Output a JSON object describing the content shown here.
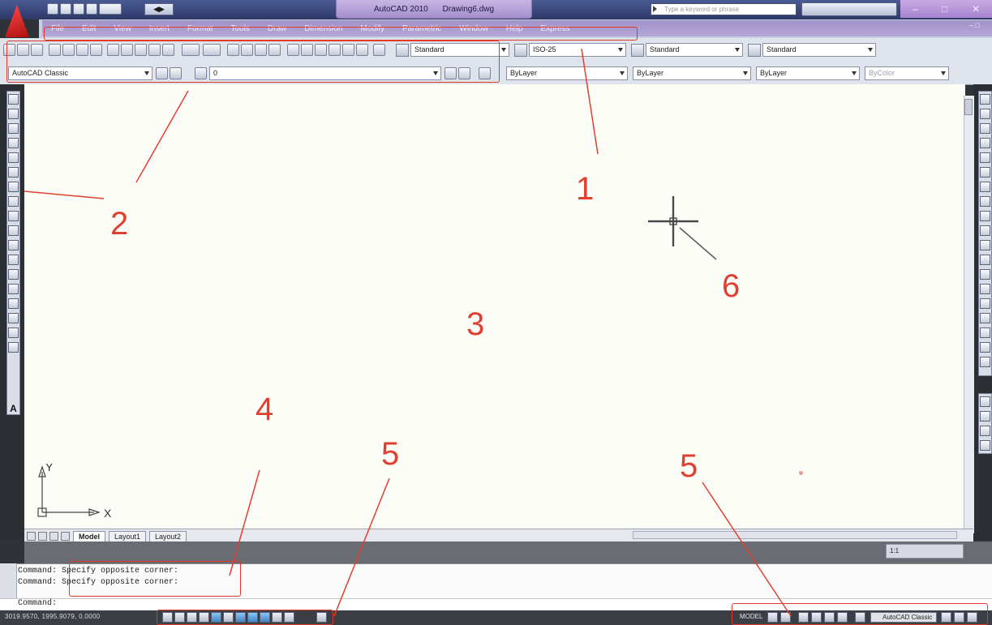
{
  "window": {
    "app_name": "AutoCAD 2010",
    "file_name": "Drawing6.dwg",
    "search_placeholder": "Type a keyword or phrase",
    "workspace_mini": "◀▶"
  },
  "menu": {
    "items": [
      "File",
      "Edit",
      "View",
      "Insert",
      "Format",
      "Tools",
      "Draw",
      "Dimension",
      "Modify",
      "Parametric",
      "Window",
      "Help",
      "Express"
    ]
  },
  "toolbar1": {
    "text_style": "Standard",
    "dim_style": "ISO-25",
    "table_style": "Standard",
    "multileader_style": "Standard"
  },
  "toolbar2": {
    "workspace": "AutoCAD Classic",
    "layer": "0",
    "color": "ByLayer",
    "linetype": "ByLayer",
    "lineweight": "ByLayer",
    "plotstyle": "ByColor"
  },
  "layout_tabs": [
    "Model",
    "Layout1",
    "Layout2"
  ],
  "command": {
    "line1": "Command: Specify opposite corner:",
    "line2": "Command: Specify opposite corner:",
    "prompt": "Command:"
  },
  "status": {
    "coordinates": "3019.9570, 1995.9079, 0.0000",
    "model": "MODEL",
    "workspace": "AutoCAD Classic"
  },
  "ucs": {
    "x_label": "X",
    "y_label": "Y"
  },
  "viewport": {
    "scale": "1:1"
  },
  "annotations": [
    "1",
    "2",
    "3",
    "4",
    "5",
    "5",
    "6"
  ],
  "colors": {
    "annotation": "#e0402f",
    "drawing_bg": "#fdfdf8",
    "menubar": "#a293c8"
  }
}
